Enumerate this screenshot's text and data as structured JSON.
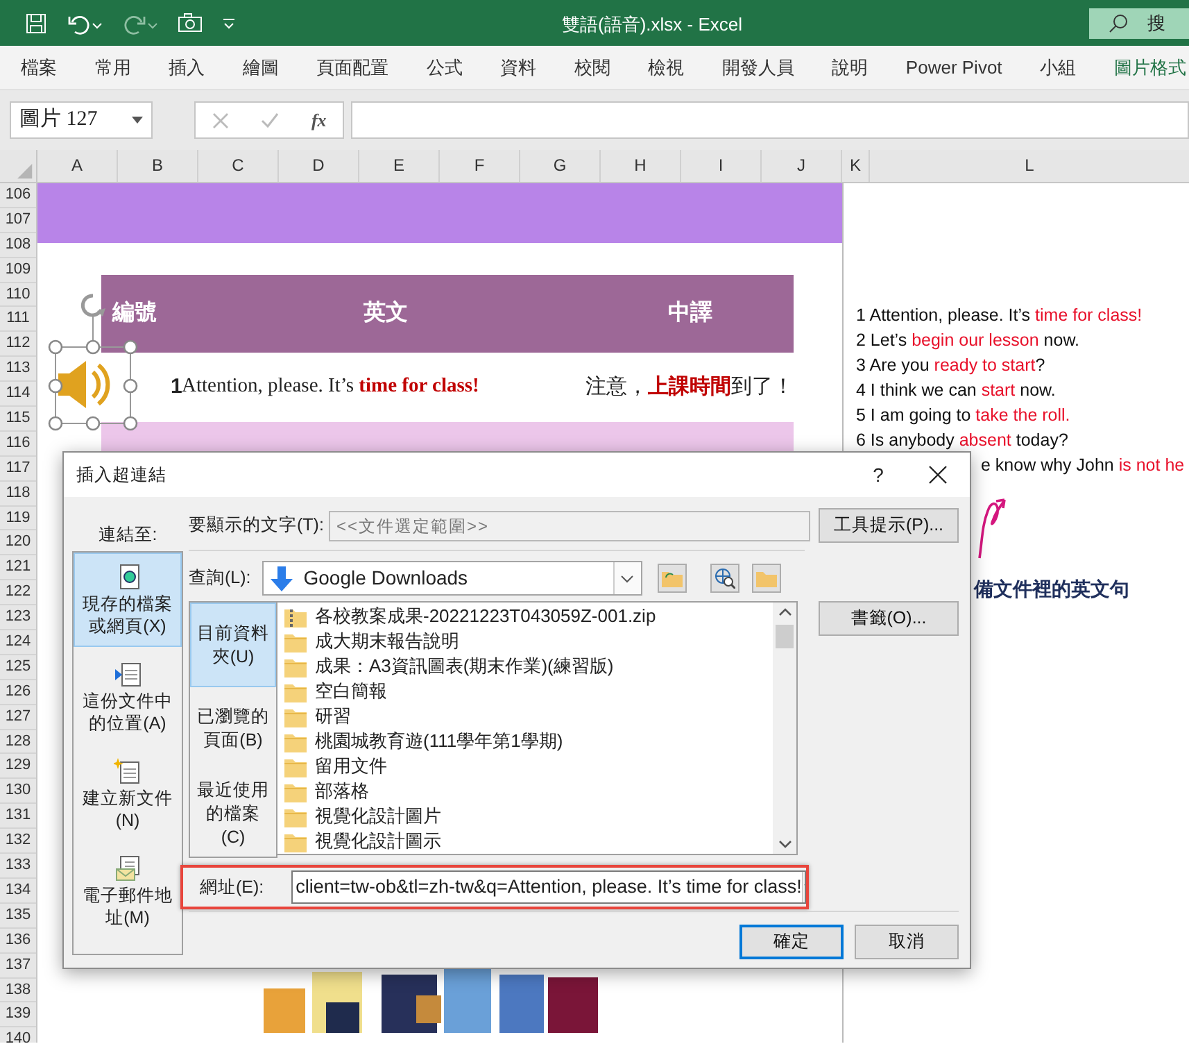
{
  "app": {
    "title": "雙語(語音).xlsx  -  Excel",
    "search_placeholder": "搜"
  },
  "ribbon_tabs": [
    {
      "label": "檔案",
      "selected": false
    },
    {
      "label": "常用",
      "selected": false
    },
    {
      "label": "插入",
      "selected": false
    },
    {
      "label": "繪圖",
      "selected": false
    },
    {
      "label": "頁面配置",
      "selected": false
    },
    {
      "label": "公式",
      "selected": false
    },
    {
      "label": "資料",
      "selected": false
    },
    {
      "label": "校閱",
      "selected": false
    },
    {
      "label": "檢視",
      "selected": false
    },
    {
      "label": "開發人員",
      "selected": false
    },
    {
      "label": "說明",
      "selected": false
    },
    {
      "label": "Power Pivot",
      "selected": false
    },
    {
      "label": "小組",
      "selected": false
    },
    {
      "label": "圖片格式",
      "selected": true
    }
  ],
  "name_box": "圖片 127",
  "formula_label": "fx",
  "columns": [
    "A",
    "B",
    "C",
    "D",
    "E",
    "F",
    "G",
    "H",
    "I",
    "J",
    "K",
    "L"
  ],
  "rows": [
    "106",
    "107",
    "108",
    "109",
    "110",
    "111",
    "112",
    "113",
    "114",
    "115",
    "116",
    "117",
    "118",
    "119",
    "120",
    "121",
    "122",
    "123",
    "124",
    "125",
    "126",
    "127",
    "128",
    "129",
    "130",
    "131",
    "132",
    "133",
    "134",
    "135",
    "136",
    "137",
    "138",
    "139",
    "140"
  ],
  "sheet": {
    "table": {
      "columns": [
        "編號",
        "英文",
        "中譯"
      ],
      "rows": [
        {
          "number": "1",
          "english": [
            {
              "text": "Attention, please. It’s ",
              "highlight": false
            },
            {
              "text": "time for class!",
              "highlight": true
            }
          ],
          "chinese": [
            {
              "text": "注意，",
              "highlight": false
            },
            {
              "text": "上課時間",
              "highlight": true
            },
            {
              "text": "到了！",
              "highlight": false
            }
          ]
        }
      ]
    },
    "sentences": [
      {
        "parts": [
          {
            "text": "1 Attention, please. It’s ",
            "highlight": false
          },
          {
            "text": "time for class!",
            "highlight": true
          }
        ]
      },
      {
        "parts": [
          {
            "text": "2 Let’s ",
            "highlight": false
          },
          {
            "text": "begin our lesson",
            "highlight": true
          },
          {
            "text": " now.",
            "highlight": false
          }
        ]
      },
      {
        "parts": [
          {
            "text": "3 Are you ",
            "highlight": false
          },
          {
            "text": "ready to start",
            "highlight": true
          },
          {
            "text": "?",
            "highlight": false
          }
        ]
      },
      {
        "parts": [
          {
            "text": "4 I think we can ",
            "highlight": false
          },
          {
            "text": "start",
            "highlight": true
          },
          {
            "text": " now.",
            "highlight": false
          }
        ]
      },
      {
        "parts": [
          {
            "text": "5 I am going to ",
            "highlight": false
          },
          {
            "text": "take the roll.",
            "highlight": true
          }
        ]
      },
      {
        "parts": [
          {
            "text": "6 Is anybody ",
            "highlight": false
          },
          {
            "text": "absent",
            "highlight": true
          },
          {
            "text": " today?",
            "highlight": false
          }
        ]
      },
      {
        "parts": [
          {
            "text": "e know why John ",
            "highlight": false
          },
          {
            "text": "is not he",
            "highlight": true
          }
        ]
      }
    ],
    "note": "備文件裡的英文句"
  },
  "dialog": {
    "title": "插入超連結",
    "help": "?",
    "link_to_label": "連結至:",
    "link_to": [
      {
        "label": "現存的檔案或網頁(X)",
        "kind": "file",
        "selected": true
      },
      {
        "label": "這份文件中的位置(A)",
        "kind": "place",
        "selected": false
      },
      {
        "label": "建立新文件(N)",
        "kind": "new",
        "selected": false
      },
      {
        "label": "電子郵件地址(M)",
        "kind": "email",
        "selected": false
      }
    ],
    "display_text": {
      "label": "要顯示的文字(T):",
      "value": "<<文件選定範圍>>"
    },
    "screen_tip_button": "工具提示(P)...",
    "look_in": {
      "label": "查詢(L):",
      "value": "Google Downloads"
    },
    "browse_tabs": [
      {
        "label": "目前資料夾(U)",
        "selected": true
      },
      {
        "label": "已瀏覽的頁面(B)",
        "selected": false
      },
      {
        "label": "最近使用的檔案(C)",
        "selected": false
      }
    ],
    "files": [
      {
        "name": "各校教案成果-20221223T043059Z-001.zip",
        "kind": "zip"
      },
      {
        "name": "成大期末報告說明",
        "kind": "folder"
      },
      {
        "name": "成果：A3資訊圖表(期末作業)(練習版)",
        "kind": "folder"
      },
      {
        "name": "空白簡報",
        "kind": "folder"
      },
      {
        "name": "研習",
        "kind": "folder"
      },
      {
        "name": "桃園城教育遊(111學年第1學期)",
        "kind": "folder"
      },
      {
        "name": "留用文件",
        "kind": "folder"
      },
      {
        "name": "部落格",
        "kind": "folder"
      },
      {
        "name": "視覺化設計圖片",
        "kind": "folder"
      },
      {
        "name": "視覺化設計圖示",
        "kind": "folder"
      }
    ],
    "bookmark_button": "書籤(O)...",
    "address": {
      "label": "網址(E):",
      "value": "client=tw-ob&tl=zh-tw&q=Attention, please. It’s time for class!",
      "highlighted": true
    },
    "buttons": [
      {
        "label": "確定",
        "default": true
      },
      {
        "label": "取消",
        "default": false
      }
    ]
  }
}
